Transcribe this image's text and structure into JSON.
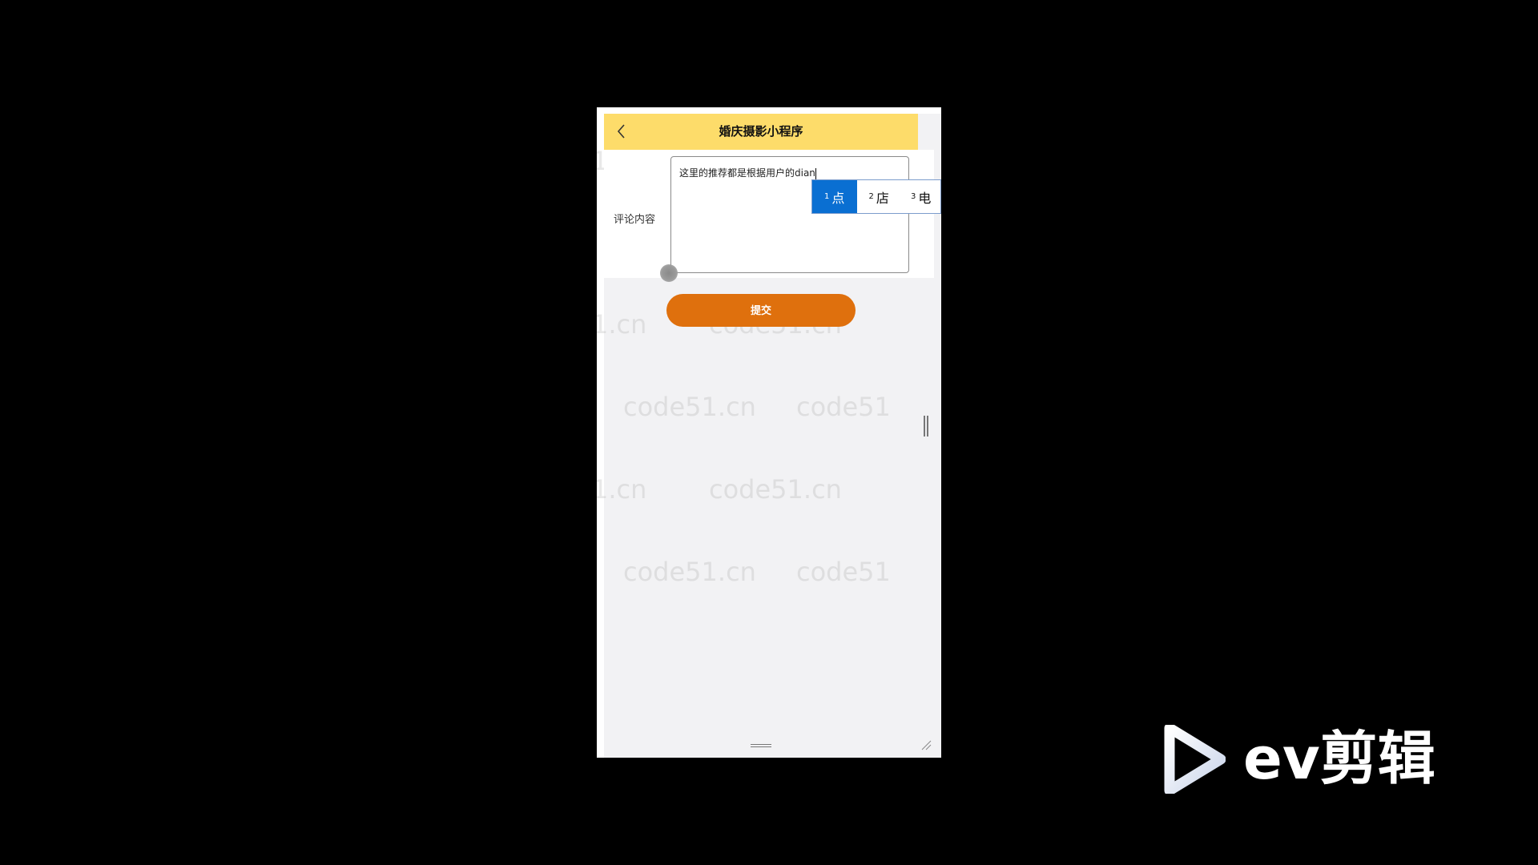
{
  "app": {
    "title": "婚庆摄影小程序",
    "back_icon": "chevron-left-icon"
  },
  "form": {
    "label": "评论内容",
    "textarea_value": "这里的推荐都是根据用户的dian"
  },
  "ime": {
    "candidates": [
      {
        "index": "1",
        "text": "点"
      },
      {
        "index": "2",
        "text": "店"
      },
      {
        "index": "3",
        "text": "电"
      }
    ],
    "selected": "1"
  },
  "submit": {
    "label": "提交"
  },
  "watermark": {
    "text": "code51.cn",
    "partial_text": "1.cn",
    "partial_text_b": "code51"
  },
  "overlay": {
    "brand": "ev剪辑"
  },
  "colors": {
    "navbar": "#fddc6a",
    "submit_button": "#df700d",
    "ime_selected": "#0a6fd2",
    "page_background": "#f2f2f4"
  }
}
